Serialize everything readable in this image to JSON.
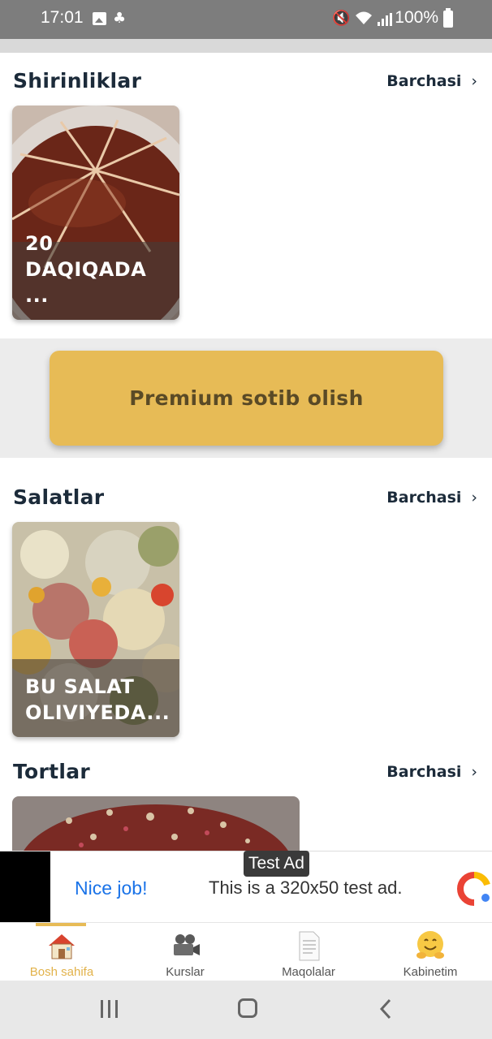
{
  "status_bar": {
    "time": "17:01",
    "battery": "100%",
    "icons": [
      "gallery-icon",
      "app-notification-icon",
      "mute-icon",
      "wifi-icon",
      "signal-icon",
      "battery-icon"
    ]
  },
  "sections": [
    {
      "title": "Shirinliklar",
      "see_all": "Barchasi",
      "cards": [
        {
          "title": "20 DAQIQADA ..."
        }
      ]
    },
    {
      "title": "Salatlar",
      "see_all": "Barchasi",
      "cards": [
        {
          "title": "BU SALAT OLIVIYEDA..."
        }
      ]
    },
    {
      "title": "Tortlar",
      "see_all": "Barchasi",
      "cards": []
    }
  ],
  "premium": {
    "label": "Premium sotib olish"
  },
  "ad": {
    "tag": "Test Ad",
    "headline": "Nice job!",
    "body": "This is a 320x50 test ad."
  },
  "bottom_nav": {
    "active_index": 0,
    "items": [
      {
        "label": "Bosh sahifa",
        "icon": "house-icon"
      },
      {
        "label": "Kurslar",
        "icon": "movie-camera-icon"
      },
      {
        "label": "Maqolalar",
        "icon": "document-icon"
      },
      {
        "label": "Kabinetim",
        "icon": "hugging-face-icon"
      }
    ]
  },
  "colors": {
    "accent": "#e7bb56",
    "ad_link": "#1a73e8",
    "title_text": "#1c2b3a"
  }
}
